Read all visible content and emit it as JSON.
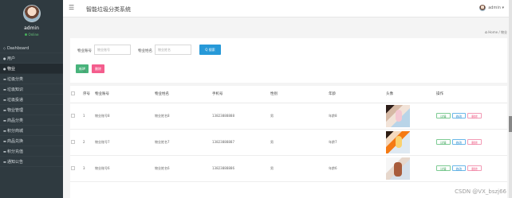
{
  "sidebar": {
    "username": "admin",
    "status": "Online",
    "items": [
      {
        "icon": "◇",
        "label": "Dashboard"
      },
      {
        "icon": "●",
        "label": "用户"
      },
      {
        "icon": "●",
        "label": "物业"
      },
      {
        "icon": "▬",
        "label": "垃圾分类"
      },
      {
        "icon": "▬",
        "label": "垃圾知识"
      },
      {
        "icon": "▬",
        "label": "垃圾投递"
      },
      {
        "icon": "▬",
        "label": "物业管理"
      },
      {
        "icon": "▬",
        "label": "商品分类"
      },
      {
        "icon": "▬",
        "label": "积分商城"
      },
      {
        "icon": "▬",
        "label": "商品兑换"
      },
      {
        "icon": "▬",
        "label": "积分充值"
      },
      {
        "icon": "▬",
        "label": "通知公告"
      }
    ],
    "active_index": 2
  },
  "header": {
    "menu_icon": "☰",
    "title": "智能垃圾分类系统",
    "user": "admin",
    "user_dropdown_icon": "▾"
  },
  "breadcrumb": {
    "home": "Home",
    "current": "物业"
  },
  "search": {
    "field1_label": "物业账号",
    "field1_placeholder": "物业账号",
    "field2_label": "物业姓名",
    "field2_placeholder": "物业姓名",
    "button": "Q 搜索"
  },
  "actions": {
    "add": "新增",
    "delete": "删除"
  },
  "table": {
    "headers": [
      "",
      "序号",
      "物业账号",
      "物业姓名",
      "手机号",
      "性别",
      "年龄",
      "头像",
      "操作"
    ],
    "rows": [
      {
        "index": "1",
        "account": "物业账号8",
        "name": "物业姓名8",
        "phone": "13823888888",
        "gender": "男",
        "age": "年龄8",
        "avatar": "photo-1"
      },
      {
        "index": "2",
        "account": "物业账号7",
        "name": "物业姓名7",
        "phone": "13823888887",
        "gender": "男",
        "age": "年龄7",
        "avatar": "photo-2"
      },
      {
        "index": "3",
        "account": "物业账号6",
        "name": "物业姓名6",
        "phone": "13823888886",
        "gender": "男",
        "age": "年龄6",
        "avatar": "photo-3"
      }
    ],
    "operations": {
      "detail": "详情",
      "edit": "修改",
      "delete": "删除"
    }
  },
  "watermark": "CSDN @VX_bszj66",
  "colors": {
    "sidebar_bg": "#2f3a40",
    "primary": "#2799d8",
    "success": "#48b37b",
    "danger": "#f45d8d"
  }
}
